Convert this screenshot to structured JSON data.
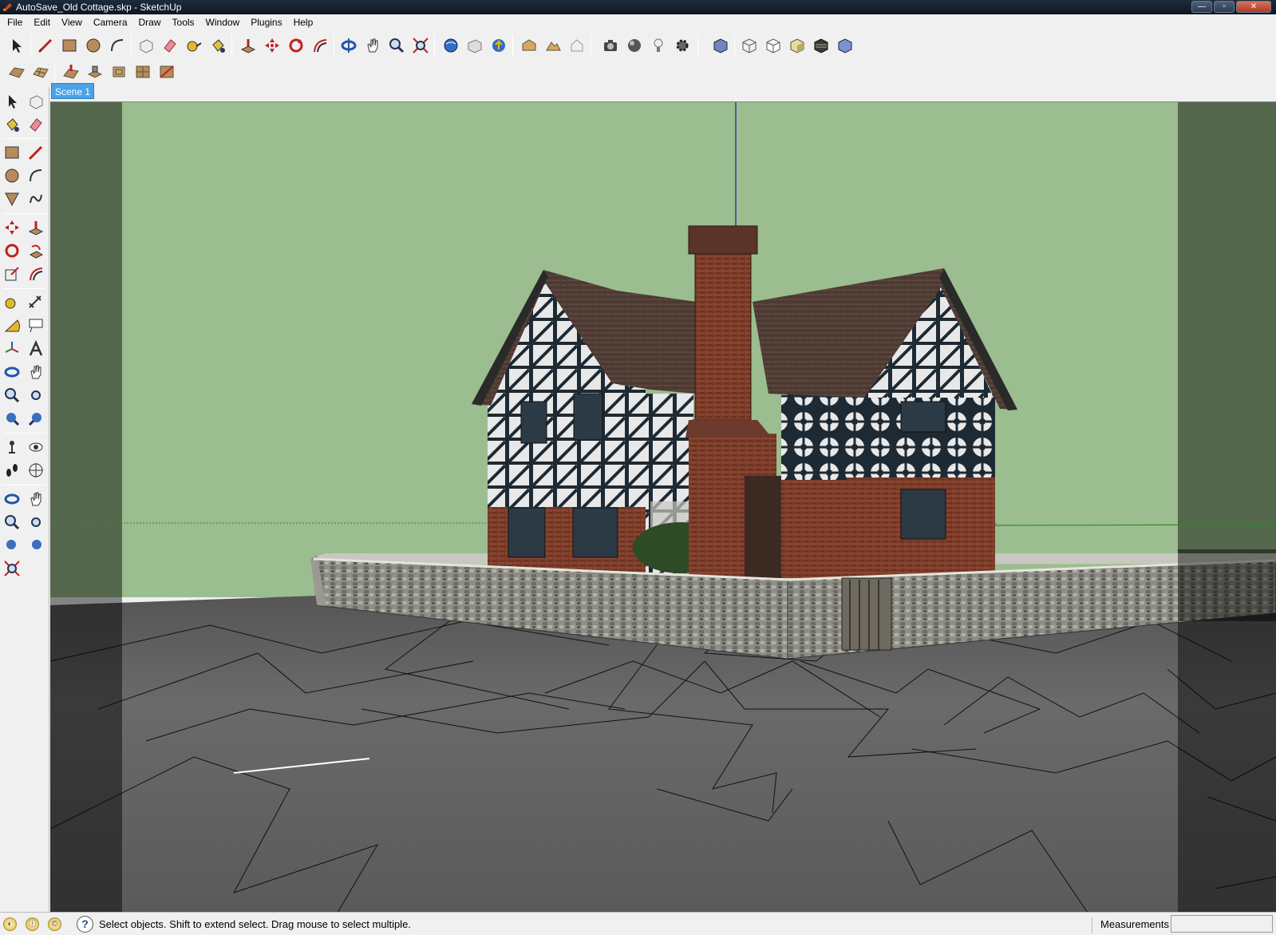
{
  "window": {
    "title": "AutoSave_Old Cottage.skp - SketchUp",
    "buttons": {
      "minimize": "—",
      "restore": "▫",
      "close": "✕"
    }
  },
  "menu": {
    "items": [
      {
        "label": "File"
      },
      {
        "label": "Edit"
      },
      {
        "label": "View"
      },
      {
        "label": "Camera"
      },
      {
        "label": "Draw"
      },
      {
        "label": "Tools"
      },
      {
        "label": "Window"
      },
      {
        "label": "Plugins"
      },
      {
        "label": "Help"
      }
    ]
  },
  "toolbar": {
    "row1_tools": [
      "select-icon",
      "line-icon",
      "rectangle-icon",
      "circle-icon",
      "arc-icon",
      "make-component-icon",
      "eraser-icon",
      "tape-measure-icon",
      "paint-bucket-icon",
      "push-pull-icon",
      "move-icon",
      "rotate-icon",
      "offset-icon",
      "orbit-icon",
      "pan-icon",
      "zoom-icon",
      "zoom-extents-icon",
      "get-models-icon",
      "share-model-icon",
      "google-earth-icon",
      "get-current-view-icon",
      "toggle-terrain-icon",
      "place-model-icon",
      "photo-textures-icon",
      "camera-icon",
      "shadows-icon",
      "light-icon",
      "styles-icon",
      "iso-view-icon",
      "top-view-icon",
      "front-view-icon",
      "xray-icon",
      "shaded-icon",
      "textured-icon"
    ],
    "row2_tools": [
      "sandbox-from-contours-icon",
      "sandbox-from-scratch-icon",
      "smoove-icon",
      "stamp-icon",
      "drape-icon",
      "add-detail-icon",
      "flip-edge-icon"
    ]
  },
  "scenes": {
    "active_tab": "Scene 1"
  },
  "status": {
    "tips": [
      "geo-location-icon",
      "credits-icon",
      "user-icon"
    ],
    "message": "Select objects. Shift to extend select. Drag mouse to select multiple.",
    "measurements_label": "Measurements",
    "measurements_value": ""
  },
  "colors": {
    "sky": "#9bbd8f",
    "sky_dim": "#4b5b47",
    "ground": "#5b5b5b",
    "scene_tab": "#4aa3e8",
    "blue_axis": "#1a1aa8",
    "red_axis": "#c01818",
    "green_axis": "#2a8a2a"
  }
}
